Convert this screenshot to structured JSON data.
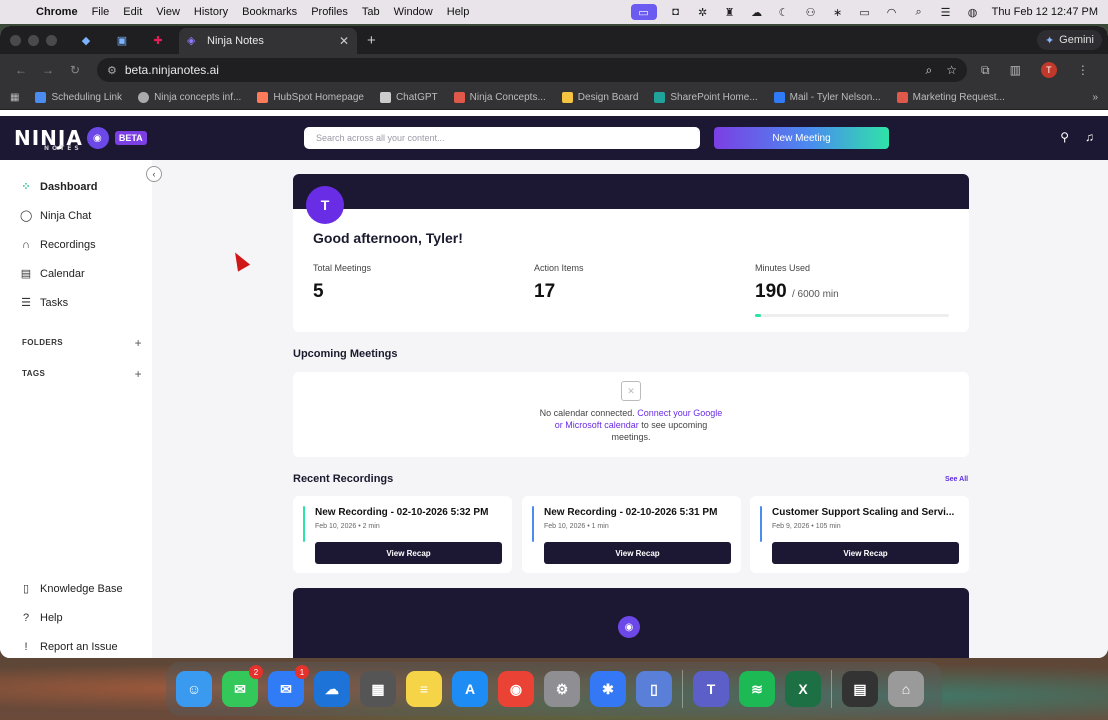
{
  "menubar": {
    "app": "Chrome",
    "items": [
      "File",
      "Edit",
      "View",
      "History",
      "Bookmarks",
      "Profiles",
      "Tab",
      "Window",
      "Help"
    ],
    "datetime": "Thu Feb 12  12:47 PM"
  },
  "browser": {
    "active_tab": "Ninja Notes",
    "gemini": "Gemini",
    "url": "beta.ninjanotes.ai",
    "profile_initial": "T",
    "bookmarks": [
      "Scheduling Link",
      "Ninja concepts inf...",
      "HubSpot Homepage",
      "ChatGPT",
      "Ninja Concepts...",
      "Design Board",
      "SharePoint Home...",
      "Mail - Tyler Nelson...",
      "Marketing Request..."
    ]
  },
  "app": {
    "logo": "NINJA",
    "logo_sub": "NOTES",
    "beta": "BETA",
    "search_placeholder": "Search across all your content...",
    "new_meeting": "New Meeting",
    "nav": [
      {
        "label": "Dashboard",
        "icon": "grid-icon"
      },
      {
        "label": "Ninja Chat",
        "icon": "chat-icon"
      },
      {
        "label": "Recordings",
        "icon": "headphones-icon"
      },
      {
        "label": "Calendar",
        "icon": "calendar-icon"
      },
      {
        "label": "Tasks",
        "icon": "tasks-icon"
      }
    ],
    "folders": "FOLDERS",
    "tags": "TAGS",
    "bottom_nav": [
      {
        "label": "Knowledge Base",
        "icon": "book-icon"
      },
      {
        "label": "Help",
        "icon": "help-icon"
      },
      {
        "label": "Report an Issue",
        "icon": "alert-icon"
      }
    ],
    "greeting": "Good afternoon, Tyler!",
    "avatar": "T",
    "stats": {
      "total_meetings_label": "Total Meetings",
      "total_meetings": "5",
      "action_items_label": "Action Items",
      "action_items": "17",
      "minutes_label": "Minutes Used",
      "minutes": "190",
      "minutes_total": "/ 6000 min",
      "minutes_fraction": 0.032
    },
    "upcoming_title": "Upcoming Meetings",
    "upcoming_text_pre": "No calendar connected. ",
    "upcoming_link": "Connect your Google or Microsoft calendar",
    "upcoming_text_post": " to see upcoming meetings.",
    "recent_title": "Recent Recordings",
    "see_all": "See All",
    "recordings": [
      {
        "title": "New Recording - 02-10-2026 5:32 PM",
        "meta": "Feb 10, 2026 • 2 min",
        "button": "View Recap",
        "color": "#2fe3a8"
      },
      {
        "title": "New Recording - 02-10-2026 5:31 PM",
        "meta": "Feb 10, 2026 • 1 min",
        "button": "View Recap",
        "color": "#4a8cf0"
      },
      {
        "title": "Customer Support Scaling and Servi...",
        "meta": "Feb 9, 2026 • 105 min",
        "button": "View Recap",
        "color": "#4a8cf0"
      }
    ]
  },
  "dock": {
    "apps": [
      {
        "name": "finder-icon",
        "color": "#3a9af0",
        "glyph": "☺"
      },
      {
        "name": "messages-icon",
        "color": "#34c759",
        "glyph": "✉",
        "badge": "2"
      },
      {
        "name": "mail-icon",
        "color": "#2f7cf6",
        "glyph": "✉",
        "badge": "1"
      },
      {
        "name": "onedrive-icon",
        "color": "#1d73d8",
        "glyph": "☁"
      },
      {
        "name": "calculator-icon",
        "color": "#555",
        "glyph": "▦"
      },
      {
        "name": "notes-icon",
        "color": "#f5d547",
        "glyph": "≡"
      },
      {
        "name": "app-store-icon",
        "color": "#1e8cf5",
        "glyph": "A"
      },
      {
        "name": "chrome-icon",
        "color": "#ea4335",
        "glyph": "◉"
      },
      {
        "name": "system-settings-icon",
        "color": "#8e8e93",
        "glyph": "⚙"
      },
      {
        "name": "freeform-icon",
        "color": "#3478f6",
        "glyph": "✱"
      },
      {
        "name": "preview-icon",
        "color": "#5a7fd8",
        "glyph": "▯"
      },
      {
        "name": "teams-icon",
        "color": "#5b5fc7",
        "glyph": "T"
      },
      {
        "name": "spotify-icon",
        "color": "#1db954",
        "glyph": "≋"
      },
      {
        "name": "excel-icon",
        "color": "#1d7044",
        "glyph": "X"
      },
      {
        "name": "downloads-icon",
        "color": "#333",
        "glyph": "▤"
      },
      {
        "name": "trash-icon",
        "color": "#9a9a9a",
        "glyph": "⌂"
      }
    ]
  }
}
